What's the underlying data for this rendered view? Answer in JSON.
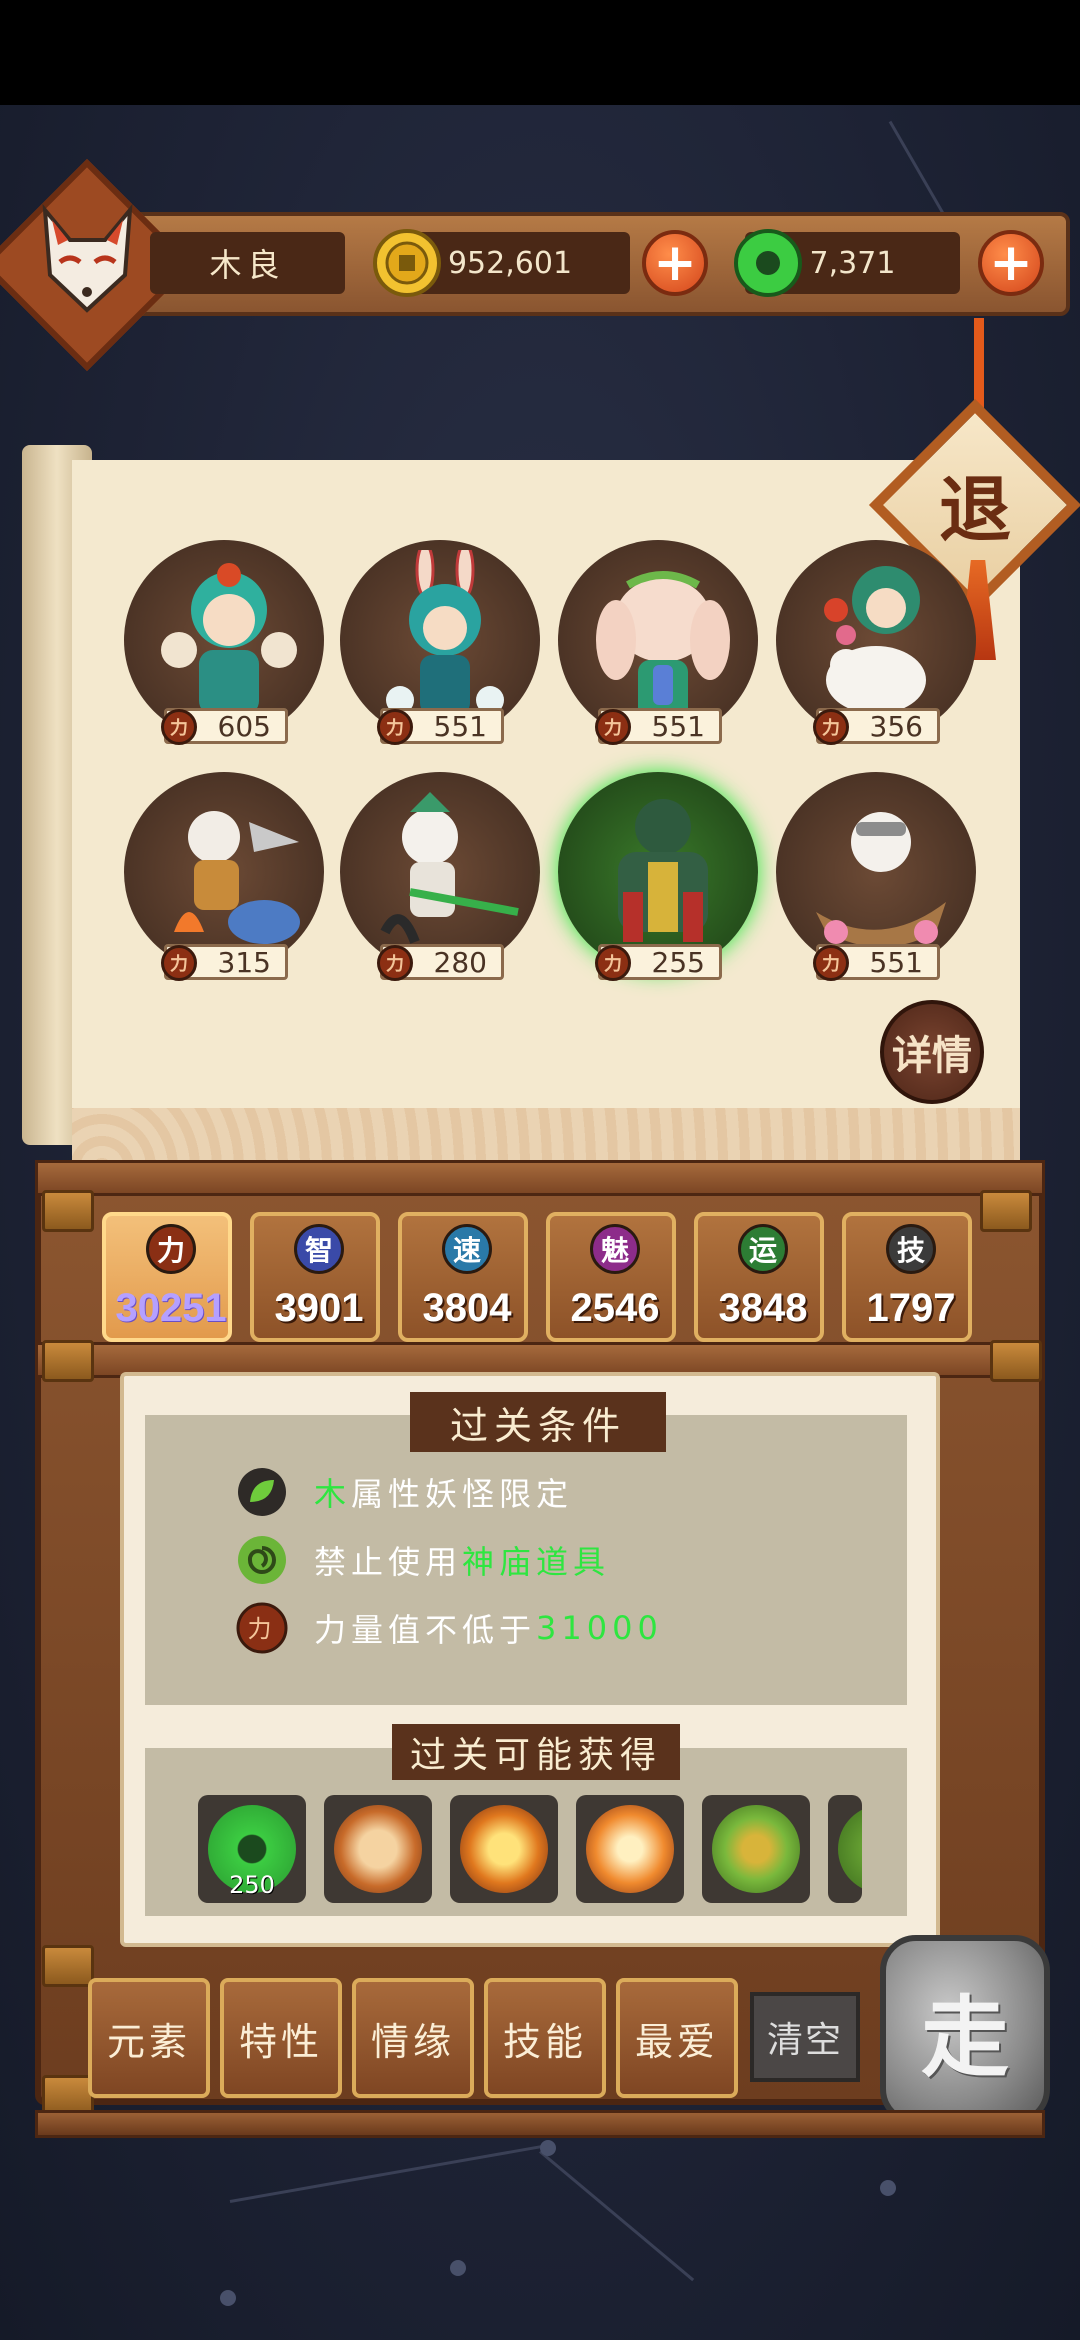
{
  "player": {
    "name": "木良"
  },
  "currency": {
    "coins": "952,601",
    "jade": "7,371",
    "plus": "+"
  },
  "retreat_label": "退",
  "detail_label": "详情",
  "monsters": [
    {
      "power": "605"
    },
    {
      "power": "551"
    },
    {
      "power": "551"
    },
    {
      "power": "356"
    },
    {
      "power": "315"
    },
    {
      "power": "280"
    },
    {
      "power": "255"
    },
    {
      "power": "551"
    }
  ],
  "power_icon_char": "力",
  "stats": [
    {
      "icon": "力",
      "value": "30251",
      "color": "#8a2f14"
    },
    {
      "icon": "智",
      "value": "3901",
      "color": "#3a4aa8"
    },
    {
      "icon": "速",
      "value": "3804",
      "color": "#2a79a8"
    },
    {
      "icon": "魅",
      "value": "2546",
      "color": "#8d2c8a"
    },
    {
      "icon": "运",
      "value": "3848",
      "color": "#2d7d34"
    },
    {
      "icon": "技",
      "value": "1797",
      "color": "#3b3b3b"
    }
  ],
  "conditions": {
    "title": "过关条件",
    "row1": {
      "highlight": "木",
      "text": "属性妖怪限定"
    },
    "row2": {
      "text": "禁止使用",
      "highlight": "神庙道具"
    },
    "row3": {
      "text": "力量值不低于",
      "highlight": "31000"
    }
  },
  "rewards": {
    "title": "过关可能获得",
    "first_count": "250"
  },
  "filters": [
    "元素",
    "特性",
    "情缘",
    "技能",
    "最爱"
  ],
  "clear_label": "清空",
  "go_label": "走",
  "colors": {
    "accent_green": "#2ee640",
    "wood": "#8c5630",
    "parchment": "#f4e9cf"
  }
}
